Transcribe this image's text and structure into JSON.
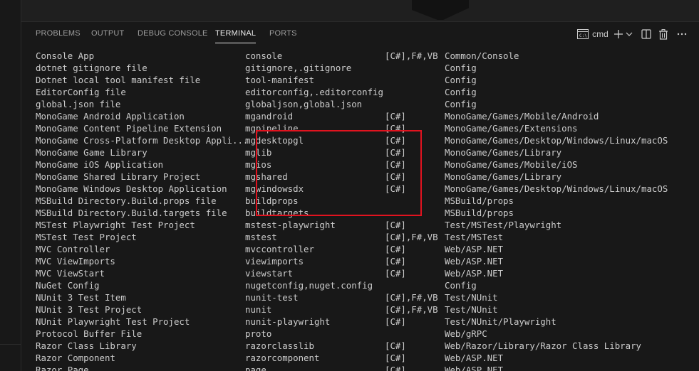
{
  "panel": {
    "tabs": [
      {
        "label": "PROBLEMS",
        "active": false
      },
      {
        "label": "OUTPUT",
        "active": false
      },
      {
        "label": "DEBUG CONSOLE",
        "active": false
      },
      {
        "label": "TERMINAL",
        "active": true
      },
      {
        "label": "PORTS",
        "active": false
      }
    ],
    "actions": {
      "terminal_name": "cmd",
      "icons": [
        "terminal-icon",
        "plus-icon",
        "chevron-down-icon",
        "split-terminal-icon",
        "trash-icon",
        "more-icon"
      ]
    }
  },
  "terminal": {
    "rows": [
      {
        "name": "Console App",
        "short": "console",
        "lang": "[C#],F#,VB",
        "tags": "Common/Console"
      },
      {
        "name": "dotnet gitignore file",
        "short": "gitignore,.gitignore",
        "lang": "",
        "tags": "Config"
      },
      {
        "name": "Dotnet local tool manifest file",
        "short": "tool-manifest",
        "lang": "",
        "tags": "Config"
      },
      {
        "name": "EditorConfig file",
        "short": "editorconfig,.editorconfig",
        "lang": "",
        "tags": "Config"
      },
      {
        "name": "global.json file",
        "short": "globaljson,global.json",
        "lang": "",
        "tags": "Config"
      },
      {
        "name": "MonoGame Android Application",
        "short": "mgandroid",
        "lang": "[C#]",
        "tags": "MonoGame/Games/Mobile/Android"
      },
      {
        "name": "MonoGame Content Pipeline Extension",
        "short": "mgpipeline",
        "lang": "[C#]",
        "tags": "MonoGame/Games/Extensions"
      },
      {
        "name": "MonoGame Cross-Platform Desktop Appli...",
        "short": "mgdesktopgl",
        "lang": "[C#]",
        "tags": "MonoGame/Games/Desktop/Windows/Linux/macOS"
      },
      {
        "name": "MonoGame Game Library",
        "short": "mglib",
        "lang": "[C#]",
        "tags": "MonoGame/Games/Library"
      },
      {
        "name": "MonoGame iOS Application",
        "short": "mgios",
        "lang": "[C#]",
        "tags": "MonoGame/Games/Mobile/iOS"
      },
      {
        "name": "MonoGame Shared Library Project",
        "short": "mgshared",
        "lang": "[C#]",
        "tags": "MonoGame/Games/Library"
      },
      {
        "name": "MonoGame Windows Desktop Application",
        "short": "mgwindowsdx",
        "lang": "[C#]",
        "tags": "MonoGame/Games/Desktop/Windows/Linux/macOS"
      },
      {
        "name": "MSBuild Directory.Build.props file",
        "short": "buildprops",
        "lang": "",
        "tags": "MSBuild/props"
      },
      {
        "name": "MSBuild Directory.Build.targets file",
        "short": "buildtargets",
        "lang": "",
        "tags": "MSBuild/props"
      },
      {
        "name": "MSTest Playwright Test Project",
        "short": "mstest-playwright",
        "lang": "[C#]",
        "tags": "Test/MSTest/Playwright"
      },
      {
        "name": "MSTest Test Project",
        "short": "mstest",
        "lang": "[C#],F#,VB",
        "tags": "Test/MSTest"
      },
      {
        "name": "MVC Controller",
        "short": "mvccontroller",
        "lang": "[C#]",
        "tags": "Web/ASP.NET"
      },
      {
        "name": "MVC ViewImports",
        "short": "viewimports",
        "lang": "[C#]",
        "tags": "Web/ASP.NET"
      },
      {
        "name": "MVC ViewStart",
        "short": "viewstart",
        "lang": "[C#]",
        "tags": "Web/ASP.NET"
      },
      {
        "name": "NuGet Config",
        "short": "nugetconfig,nuget.config",
        "lang": "",
        "tags": "Config"
      },
      {
        "name": "NUnit 3 Test Item",
        "short": "nunit-test",
        "lang": "[C#],F#,VB",
        "tags": "Test/NUnit"
      },
      {
        "name": "NUnit 3 Test Project",
        "short": "nunit",
        "lang": "[C#],F#,VB",
        "tags": "Test/NUnit"
      },
      {
        "name": "NUnit Playwright Test Project",
        "short": "nunit-playwright",
        "lang": "[C#]",
        "tags": "Test/NUnit/Playwright"
      },
      {
        "name": "Protocol Buffer File",
        "short": "proto",
        "lang": "",
        "tags": "Web/gRPC"
      },
      {
        "name": "Razor Class Library",
        "short": "razorclasslib",
        "lang": "[C#]",
        "tags": "Web/Razor/Library/Razor Class Library"
      },
      {
        "name": "Razor Component",
        "short": "razorcomponent",
        "lang": "[C#]",
        "tags": "Web/ASP.NET"
      },
      {
        "name": "Razor Page",
        "short": "page",
        "lang": "[C#]",
        "tags": "Web/ASP.NET"
      }
    ]
  },
  "colors": {
    "background": "#181818",
    "text": "#cccccc",
    "highlight_box": "#e1131f"
  }
}
